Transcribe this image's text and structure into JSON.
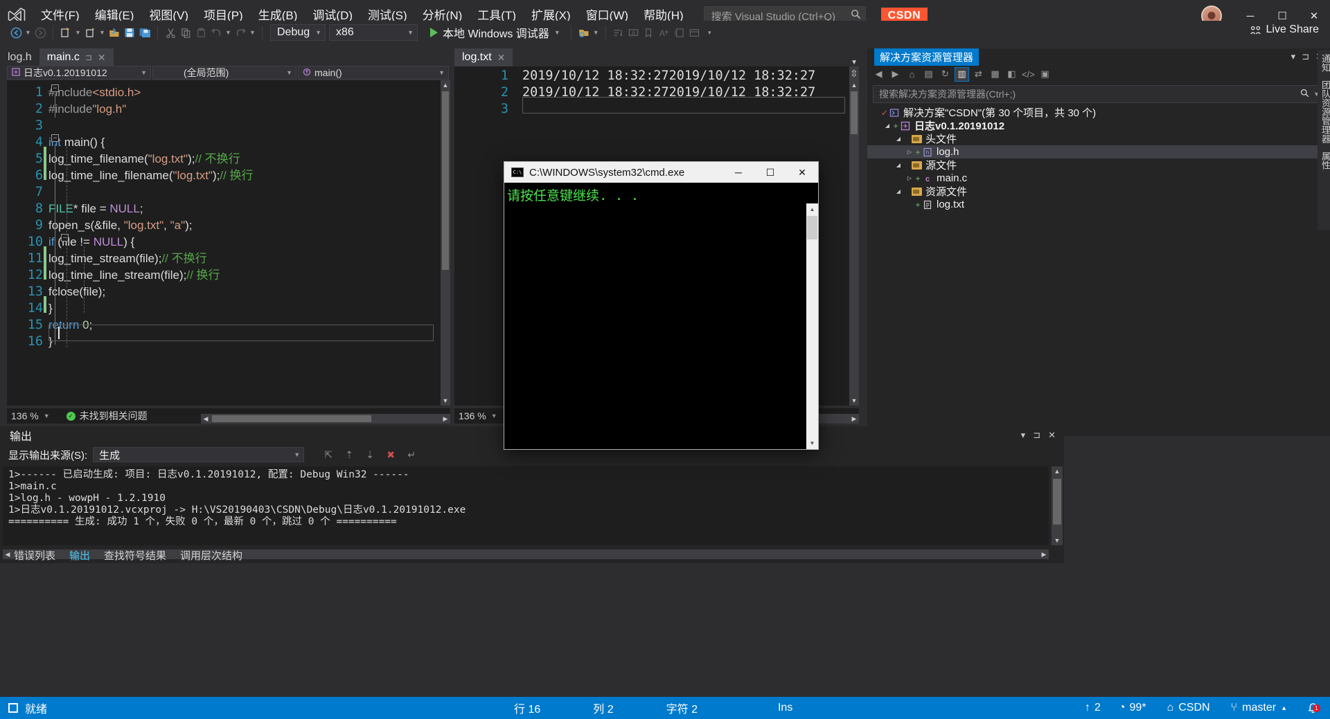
{
  "app": {
    "name": "Visual Studio",
    "csdn_badge": "CSDN"
  },
  "menu": [
    {
      "label": "文件(F)",
      "name": "menu-file"
    },
    {
      "label": "编辑(E)",
      "name": "menu-edit"
    },
    {
      "label": "视图(V)",
      "name": "menu-view"
    },
    {
      "label": "项目(P)",
      "name": "menu-project"
    },
    {
      "label": "生成(B)",
      "name": "menu-build"
    },
    {
      "label": "调试(D)",
      "name": "menu-debug"
    },
    {
      "label": "测试(S)",
      "name": "menu-test"
    },
    {
      "label": "分析(N)",
      "name": "menu-analyze"
    },
    {
      "label": "工具(T)",
      "name": "menu-tools"
    },
    {
      "label": "扩展(X)",
      "name": "menu-extensions"
    },
    {
      "label": "窗口(W)",
      "name": "menu-window"
    },
    {
      "label": "帮助(H)",
      "name": "menu-help"
    }
  ],
  "search": {
    "placeholder": "搜索 Visual Studio (Ctrl+Q)"
  },
  "window_controls": {
    "minimize": "─",
    "maximize": "☐",
    "close": "✕"
  },
  "toolbar": {
    "config": "Debug",
    "platform": "x86",
    "run_label": "本地 Windows 调试器",
    "live_share": "Live Share"
  },
  "editor_left": {
    "tabs": [
      {
        "label": "log.h",
        "active": false
      },
      {
        "label": "main.c",
        "active": true
      }
    ],
    "nav": {
      "project": "日志v0.1.20191012",
      "scope": "(全局范围)",
      "member": "main()"
    },
    "zoom": "136 %",
    "issues": "未找到相关问题",
    "lines": [
      {
        "n": "1",
        "segments": [
          {
            "t": "#include",
            "c": "pp"
          },
          {
            "t": "<stdio.h>",
            "c": "str"
          }
        ]
      },
      {
        "n": "2",
        "segments": [
          {
            "t": "#include",
            "c": "pp"
          },
          {
            "t": "\"log.h\"",
            "c": "str"
          }
        ]
      },
      {
        "n": "3",
        "segments": []
      },
      {
        "n": "4",
        "segments": [
          {
            "t": "int",
            "c": "kw"
          },
          {
            "t": " main() {",
            "c": "pl"
          }
        ]
      },
      {
        "n": "5",
        "segments": [
          {
            "t": "    log_time_filename(",
            "c": "pl"
          },
          {
            "t": "\"log.txt\"",
            "c": "str"
          },
          {
            "t": ");",
            "c": "pl"
          },
          {
            "t": "// 不换行",
            "c": "cmt"
          }
        ]
      },
      {
        "n": "6",
        "segments": [
          {
            "t": "    log_time_line_filename(",
            "c": "pl"
          },
          {
            "t": "\"log.txt\"",
            "c": "str"
          },
          {
            "t": ");",
            "c": "pl"
          },
          {
            "t": "// 换行",
            "c": "cmt"
          }
        ]
      },
      {
        "n": "7",
        "segments": []
      },
      {
        "n": "8",
        "segments": [
          {
            "t": "    ",
            "c": "pl"
          },
          {
            "t": "FILE",
            "c": "typ"
          },
          {
            "t": "* file = ",
            "c": "pl"
          },
          {
            "t": "NULL",
            "c": "mac"
          },
          {
            "t": ";",
            "c": "pl"
          }
        ]
      },
      {
        "n": "9",
        "segments": [
          {
            "t": "    fopen_s(&file, ",
            "c": "pl"
          },
          {
            "t": "\"log.txt\"",
            "c": "str"
          },
          {
            "t": ", ",
            "c": "pl"
          },
          {
            "t": "\"a\"",
            "c": "str"
          },
          {
            "t": ");",
            "c": "pl"
          }
        ]
      },
      {
        "n": "10",
        "segments": [
          {
            "t": "    ",
            "c": "pl"
          },
          {
            "t": "if",
            "c": "kw"
          },
          {
            "t": " (file != ",
            "c": "pl"
          },
          {
            "t": "NULL",
            "c": "mac"
          },
          {
            "t": ") {",
            "c": "pl"
          }
        ]
      },
      {
        "n": "11",
        "segments": [
          {
            "t": "        log_time_stream(file);",
            "c": "pl"
          },
          {
            "t": "// 不换行",
            "c": "cmt"
          }
        ]
      },
      {
        "n": "12",
        "segments": [
          {
            "t": "        log_time_line_stream(file);",
            "c": "pl"
          },
          {
            "t": "// 换行",
            "c": "cmt"
          }
        ]
      },
      {
        "n": "13",
        "segments": [
          {
            "t": "        fclose(file);",
            "c": "pl"
          }
        ]
      },
      {
        "n": "14",
        "segments": [
          {
            "t": "    }",
            "c": "pl"
          }
        ]
      },
      {
        "n": "15",
        "segments": [
          {
            "t": "    ",
            "c": "pl"
          },
          {
            "t": "return",
            "c": "kw"
          },
          {
            "t": " ",
            "c": "pl"
          },
          {
            "t": "0",
            "c": "num"
          },
          {
            "t": ";",
            "c": "pl"
          }
        ]
      },
      {
        "n": "16",
        "segments": [
          {
            "t": "}",
            "c": "pl"
          }
        ]
      }
    ]
  },
  "editor_right": {
    "tabs": [
      {
        "label": "log.txt",
        "active": true
      }
    ],
    "zoom": "136 %",
    "lines": [
      {
        "n": "1",
        "text": "2019/10/12 18:32:272019/10/12 18:32:27"
      },
      {
        "n": "2",
        "text": "2019/10/12 18:32:272019/10/12 18:32:27"
      },
      {
        "n": "3",
        "text": ""
      }
    ]
  },
  "solution_explorer": {
    "title": "解决方案资源管理器",
    "search_placeholder": "搜索解决方案资源管理器(Ctrl+;)",
    "tree": [
      {
        "label": "解决方案\"CSDN\"(第 30 个项目，共 30 个)",
        "indent": 0,
        "icon": "solution-icon",
        "twisty": "",
        "plus": false,
        "bold": false,
        "selected": false
      },
      {
        "label": "日志v0.1.20191012",
        "indent": 1,
        "icon": "project-icon",
        "twisty": "◢",
        "plus": true,
        "bold": true,
        "selected": false
      },
      {
        "label": "头文件",
        "indent": 2,
        "icon": "folder-icon",
        "twisty": "◢",
        "plus": false,
        "bold": false,
        "selected": false
      },
      {
        "label": "log.h",
        "indent": 3,
        "icon": "header-file-icon",
        "twisty": "▷",
        "plus": true,
        "bold": false,
        "selected": true
      },
      {
        "label": "源文件",
        "indent": 2,
        "icon": "folder-icon",
        "twisty": "◢",
        "plus": false,
        "bold": false,
        "selected": false
      },
      {
        "label": "main.c",
        "indent": 3,
        "icon": "c-file-icon",
        "twisty": "▷",
        "plus": true,
        "bold": false,
        "selected": false
      },
      {
        "label": "资源文件",
        "indent": 2,
        "icon": "folder-icon",
        "twisty": "◢",
        "plus": false,
        "bold": false,
        "selected": false
      },
      {
        "label": "log.txt",
        "indent": 3,
        "icon": "text-file-icon",
        "twisty": "",
        "plus": true,
        "bold": false,
        "selected": false
      }
    ],
    "side_tabs": [
      "通知",
      "团队资源管理器",
      "属性"
    ]
  },
  "output": {
    "title": "输出",
    "source_label": "显示输出来源(S):",
    "source_value": "生成",
    "lines": [
      "1>------ 已启动生成: 项目: 日志v0.1.20191012, 配置: Debug Win32 ------",
      "1>main.c",
      "1>log.h - wowpH - 1.2.1910",
      "1>日志v0.1.20191012.vcxproj -> H:\\VS20190403\\CSDN\\Debug\\日志v0.1.20191012.exe",
      "========== 生成: 成功 1 个，失败 0 个，最新 0 个，跳过 0 个 =========="
    ],
    "bottom_tabs": [
      {
        "label": "错误列表",
        "active": false
      },
      {
        "label": "输出",
        "active": true
      },
      {
        "label": "查找符号结果",
        "active": false
      },
      {
        "label": "调用层次结构",
        "active": false
      }
    ]
  },
  "cmd_window": {
    "title": "C:\\WINDOWS\\system32\\cmd.exe",
    "icon_label": "C:\\",
    "text": "请按任意键继续. . .",
    "buttons": {
      "minimize": "─",
      "maximize": "☐",
      "close": "✕"
    }
  },
  "statusbar": {
    "ready": "就绪",
    "row_label": "行 16",
    "col_label": "列 2",
    "char_label": "字符 2",
    "ins_label": "Ins",
    "up_count": "2",
    "percent": "99*",
    "csdn": "CSDN",
    "branch": "master",
    "notify_count": "1"
  },
  "colors": {
    "accent": "#007acc",
    "csdn_red": "#fc5531",
    "status_bg": "#007acc",
    "comment_green": "#57a64a",
    "string_orange": "#d69d85"
  }
}
